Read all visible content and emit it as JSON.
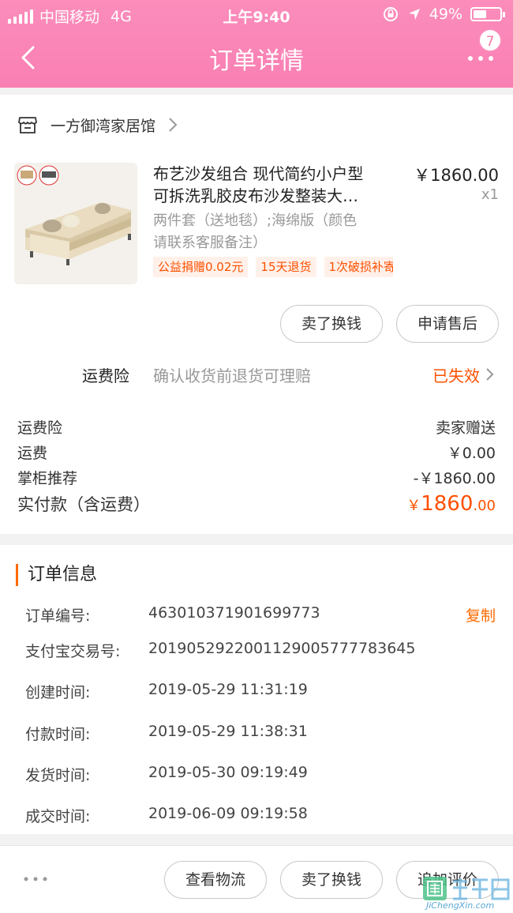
{
  "status_bar": {
    "carrier": "中国移动",
    "network": "4G",
    "time": "上午9:40",
    "battery": "49%",
    "battery_level": 0.49
  },
  "nav": {
    "title": "订单详情",
    "badge": "7"
  },
  "shop": {
    "name": "一方御湾家居馆"
  },
  "product": {
    "title_line1": "布艺沙发组合 现代简约小户型",
    "title_line2": "可拆洗乳胶皮布沙发整装大…",
    "price": "￥1860.00",
    "qty": "x1",
    "sku_line1": "两件套（送地毯）;海绵版（颜色",
    "sku_line2": "请联系客服备注）",
    "tags": [
      "公益捐赠0.02元",
      "15天退货",
      "1次破损补寄"
    ]
  },
  "item_actions": {
    "sell_label": "卖了换钱",
    "aftersale_label": "申请售后"
  },
  "insurance": {
    "label": "运费险",
    "desc": "确认收货前退货可理赔",
    "status": "已失效"
  },
  "fees": [
    {
      "label": "运费险",
      "value": "卖家赠送"
    },
    {
      "label": "运费",
      "value": "￥0.00"
    },
    {
      "label": "掌柜推荐",
      "value": "-￥1860.00"
    }
  ],
  "paid": {
    "label": "实付款（含运费）",
    "currency": "￥",
    "integer": "1860",
    "decimal": ".00"
  },
  "order_info": {
    "title": "订单信息",
    "copy_label": "复制",
    "rows": [
      {
        "label": "订单编号:",
        "value": "463010371901699773"
      },
      {
        "label": "支付宝交易号:",
        "value": "2019052922001129005777783645"
      },
      {
        "label": "创建时间:",
        "value": "2019-05-29 11:31:19"
      },
      {
        "label": "付款时间:",
        "value": "2019-05-29 11:38:31"
      },
      {
        "label": "发货时间:",
        "value": "2019-05-30 09:19:49"
      },
      {
        "label": "成交时间:",
        "value": "2019-06-09 09:19:58"
      }
    ]
  },
  "bottom_actions": {
    "logistics_label": "查看物流",
    "sell_label": "卖了换钱",
    "review_label": "追加评价"
  },
  "watermark": {
    "text": "JiChengXin.com",
    "logo_text": "集诚信"
  }
}
